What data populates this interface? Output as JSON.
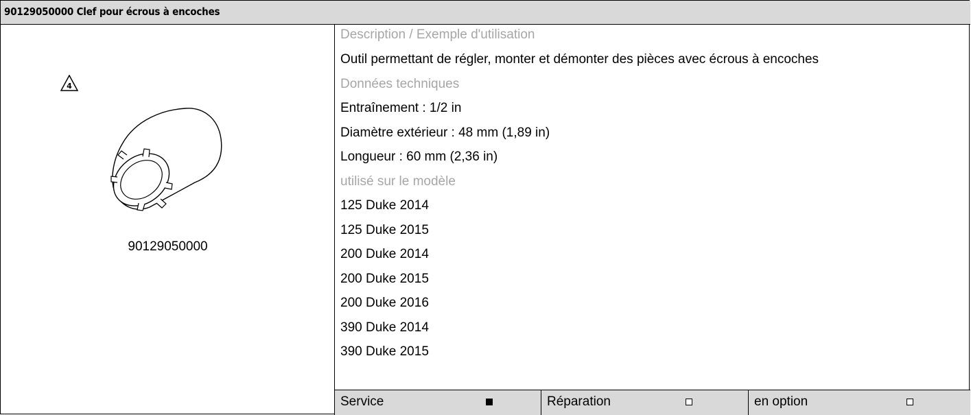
{
  "header": {
    "title": "90129050000 Clef pour écrous à encoches"
  },
  "image_panel": {
    "warning_icon": "warning-triangle-4-icon",
    "warning_number": "4",
    "tool_icon": "notched-nut-socket-wrench",
    "part_number": "90129050000"
  },
  "details": {
    "description_label": "Description / Exemple d'utilisation",
    "description": "Outil permettant de régler, monter et démonter des pièces avec écrous à encoches",
    "tech_label": "Données techniques",
    "tech": [
      "Entraînement : 1/2 in",
      "Diamètre extérieur : 48 mm (1,89 in)",
      "Longueur : 60 mm (2,36 in)"
    ],
    "models_label": "utilisé sur le modèle",
    "models": [
      "125 Duke 2014",
      "125 Duke 2015",
      "200 Duke 2014",
      "200 Duke 2015",
      "200 Duke 2016",
      "390 Duke 2014",
      "390 Duke 2015"
    ]
  },
  "footer": {
    "service": {
      "label": "Service",
      "checked": true
    },
    "repair": {
      "label": "Réparation",
      "checked": false
    },
    "optional": {
      "label": "en option",
      "checked": false
    }
  }
}
